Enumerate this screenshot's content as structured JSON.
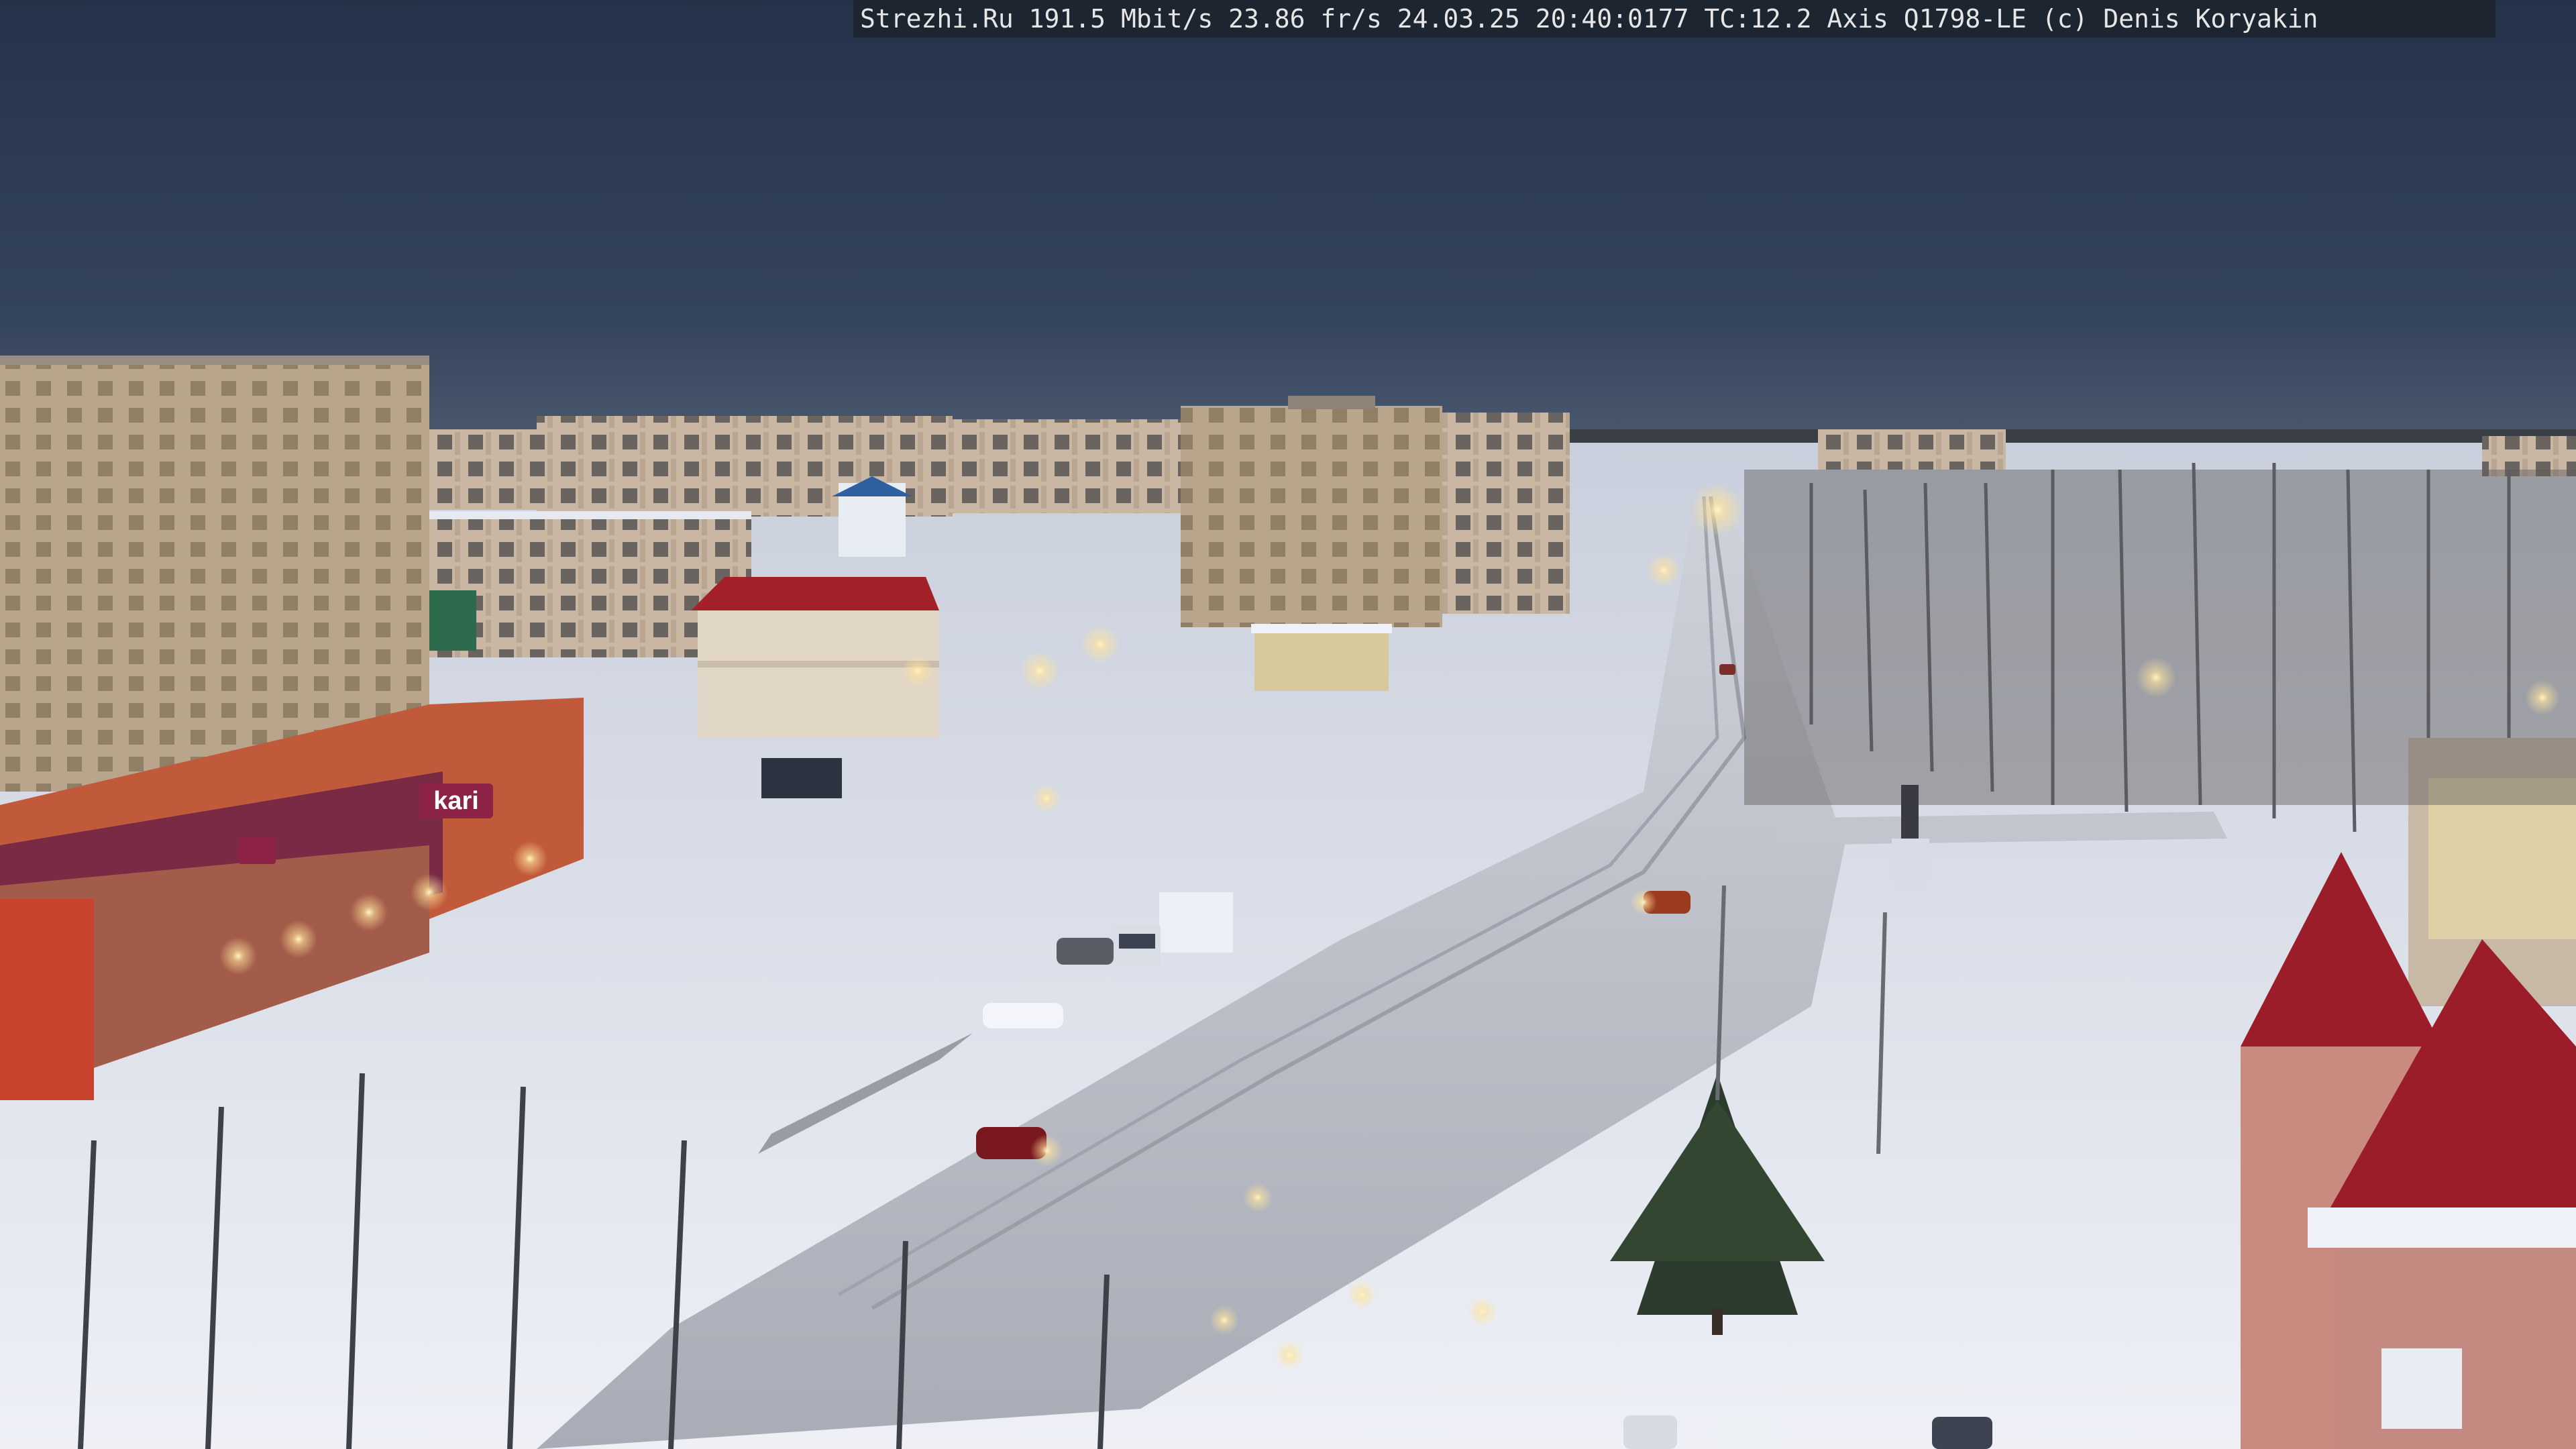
{
  "overlay": {
    "site": "Strezhi.Ru",
    "bitrate": "191.5 Mbit/s",
    "framerate": "23.86 fr/s",
    "date": "24.03.25",
    "time": "20:40:0177",
    "tc": "TC:12.2",
    "camera": "Axis Q1798-LE",
    "credit": "(c) Denis Koryakin"
  },
  "signs": {
    "store_brand": "kari"
  },
  "colors": {
    "sky_top": "#2a3a52",
    "sky_horizon": "#4a5a70",
    "snow": "#dfe3ee",
    "street_light": "#ffe7a8",
    "roof_red": "#a3222a"
  }
}
